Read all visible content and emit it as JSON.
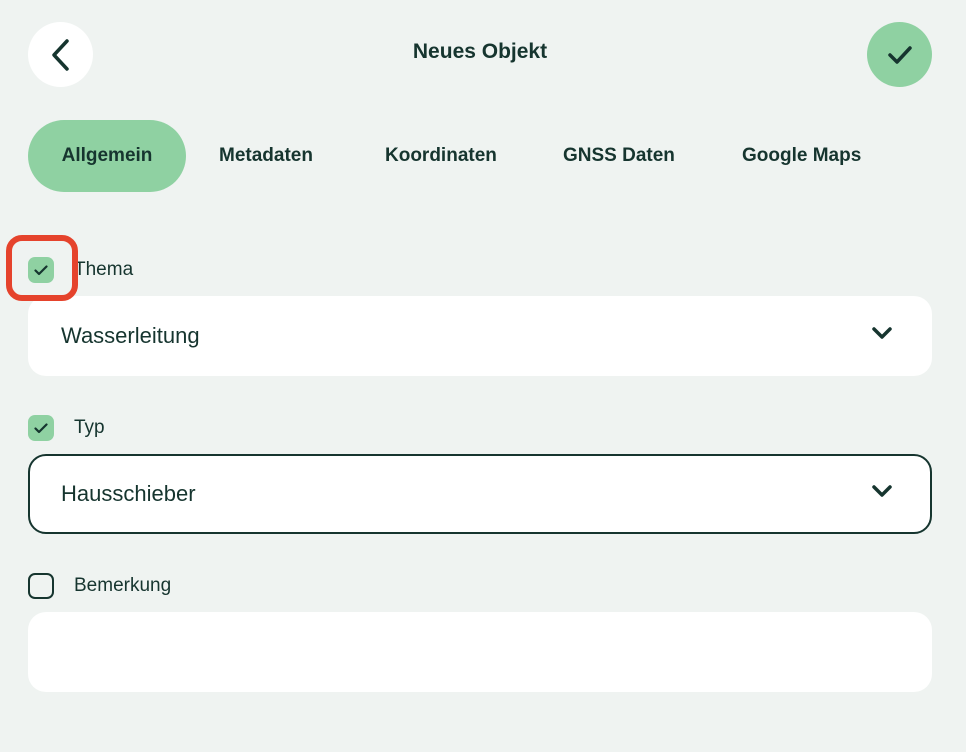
{
  "header": {
    "title": "Neues Objekt",
    "back_icon": "chevron-left-icon",
    "confirm_icon": "check-icon"
  },
  "tabs": [
    {
      "label": "Allgemein",
      "active": true
    },
    {
      "label": "Metadaten",
      "active": false
    },
    {
      "label": "Koordinaten",
      "active": false
    },
    {
      "label": "GNSS Daten",
      "active": false
    },
    {
      "label": "Google Maps",
      "active": false
    }
  ],
  "fields": {
    "thema": {
      "label": "Thema",
      "checked": true,
      "value": "Wasserleitung"
    },
    "typ": {
      "label": "Typ",
      "checked": true,
      "value": "Hausschieber"
    },
    "bemerkung": {
      "label": "Bemerkung",
      "checked": false,
      "value": ""
    }
  },
  "colors": {
    "background": "#eff3f1",
    "accent": "#8fd1a2",
    "text": "#16352f",
    "highlight": "#e5432c"
  }
}
